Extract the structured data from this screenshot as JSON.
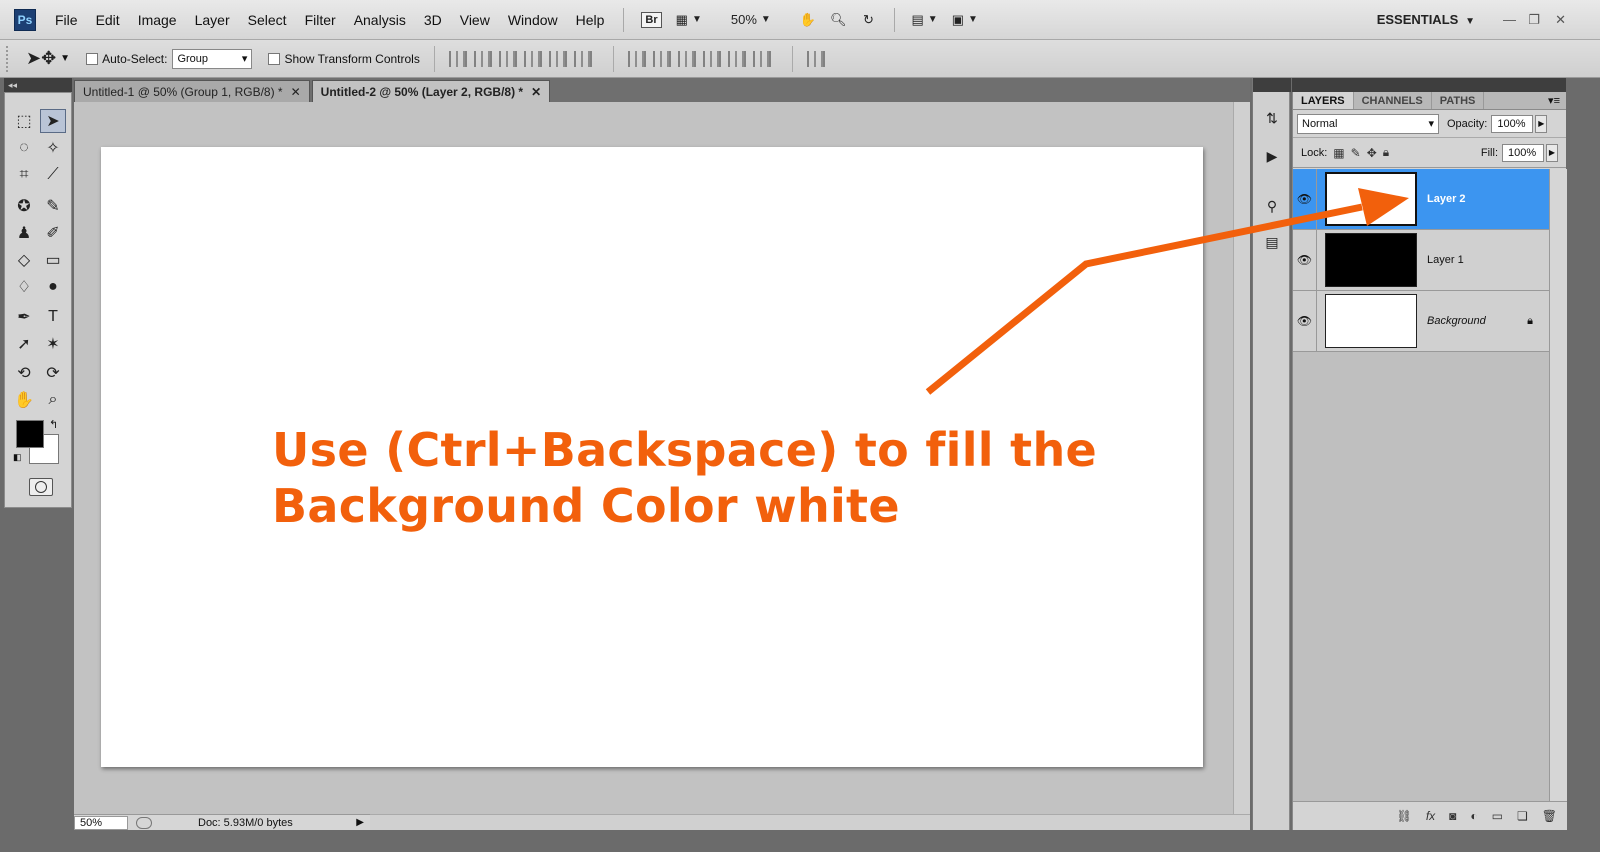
{
  "app": {
    "logo": "Ps",
    "menus": [
      "File",
      "Edit",
      "Image",
      "Layer",
      "Select",
      "Filter",
      "Analysis",
      "3D",
      "View",
      "Window",
      "Help"
    ],
    "bridge_label": "Br",
    "zoom_level": "50%",
    "workspace": "ESSENTIALS"
  },
  "options_bar": {
    "auto_select_label": "Auto-Select:",
    "auto_select_value": "Group",
    "show_transform_label": "Show Transform Controls"
  },
  "tabs": [
    {
      "label": "Untitled-1 @ 50% (Group 1, RGB/8) *",
      "active": false
    },
    {
      "label": "Untitled-2 @ 50% (Layer 2, RGB/8) *",
      "active": true
    }
  ],
  "canvas": {
    "annotation_line1": "Use (Ctrl+Backspace) to fill the",
    "annotation_line2": "Background Color white",
    "annotation_color": "#f2600c"
  },
  "status": {
    "zoom": "50%",
    "doc_info": "Doc: 5.93M/0 bytes"
  },
  "layers_panel": {
    "tabs": [
      "LAYERS",
      "CHANNELS",
      "PATHS"
    ],
    "blend_mode": "Normal",
    "opacity_label": "Opacity:",
    "opacity_value": "100%",
    "lock_label": "Lock:",
    "fill_label": "Fill:",
    "fill_value": "100%",
    "layers": [
      {
        "name": "Layer 2",
        "selected": true,
        "thumb": "#ffffff"
      },
      {
        "name": "Layer 1",
        "selected": false,
        "thumb": "#000000"
      },
      {
        "name": "Background",
        "selected": false,
        "thumb": "#ffffff"
      }
    ]
  },
  "colors": {
    "foreground": "#000000",
    "background": "#ffffff",
    "selection": "#3c95f0"
  }
}
